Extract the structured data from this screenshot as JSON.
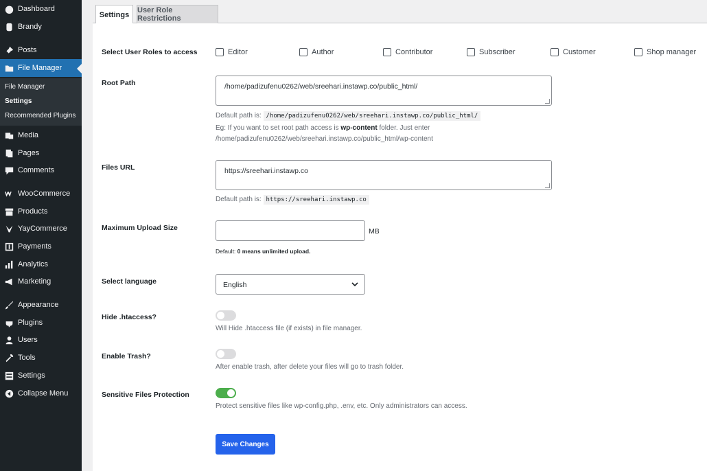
{
  "sidebar": {
    "items": [
      {
        "label": "Dashboard",
        "icon": "dashboard-icon"
      },
      {
        "label": "Brandy",
        "icon": "brandy-icon"
      },
      {
        "label": "Posts",
        "icon": "pin-icon"
      },
      {
        "label": "File Manager",
        "icon": "folder-icon"
      },
      {
        "label": "Media",
        "icon": "media-icon"
      },
      {
        "label": "Pages",
        "icon": "pages-icon"
      },
      {
        "label": "Comments",
        "icon": "comment-icon"
      },
      {
        "label": "WooCommerce",
        "icon": "woocommerce-icon"
      },
      {
        "label": "Products",
        "icon": "archive-icon"
      },
      {
        "label": "YayCommerce",
        "icon": "yaycommerce-icon"
      },
      {
        "label": "Payments",
        "icon": "payments-icon"
      },
      {
        "label": "Analytics",
        "icon": "analytics-icon"
      },
      {
        "label": "Marketing",
        "icon": "megaphone-icon"
      },
      {
        "label": "Appearance",
        "icon": "brush-icon"
      },
      {
        "label": "Plugins",
        "icon": "plugin-icon"
      },
      {
        "label": "Users",
        "icon": "user-icon"
      },
      {
        "label": "Tools",
        "icon": "wrench-icon"
      },
      {
        "label": "Settings",
        "icon": "settings-icon"
      },
      {
        "label": "Collapse Menu",
        "icon": "collapse-icon"
      }
    ],
    "submenu": [
      "File Manager",
      "Settings",
      "Recommended Plugins"
    ]
  },
  "tabs": {
    "settings": "Settings",
    "restrictions": "User Role Restrictions"
  },
  "roles": {
    "label": "Select User Roles to access",
    "options": [
      "Editor",
      "Author",
      "Contributor",
      "Subscriber",
      "Customer",
      "Shop manager"
    ]
  },
  "root_path": {
    "label": "Root Path",
    "value": "/home/padizufenu0262/web/sreehari.instawp.co/public_html/",
    "default_prefix": "Default path is:",
    "default_value": "/home/padizufenu0262/web/sreehari.instawp.co/public_html/",
    "eg_prefix": "Eg: If you want to set root path access is",
    "eg_strong": "wp-content",
    "eg_suffix": "folder. Just enter",
    "eg_path": "/home/padizufenu0262/web/sreehari.instawp.co/public_html/wp-content"
  },
  "files_url": {
    "label": "Files URL",
    "value": "https://sreehari.instawp.co",
    "default_prefix": "Default path is:",
    "default_value": "https://sreehari.instawp.co"
  },
  "upload": {
    "label": "Maximum Upload Size",
    "value": "",
    "unit": "MB",
    "note_prefix": "Default:",
    "note_strong": "0 means unlimited upload."
  },
  "language": {
    "label": "Select language",
    "value": "English"
  },
  "htaccess": {
    "label": "Hide .htaccess?",
    "enabled": false,
    "desc": "Will Hide .htaccess file (if exists) in file manager."
  },
  "trash": {
    "label": "Enable Trash?",
    "enabled": false,
    "desc": "After enable trash, after delete your files will go to trash folder."
  },
  "sensitive": {
    "label": "Sensitive Files Protection",
    "enabled": true,
    "desc": "Protect sensitive files like wp-config.php, .env, etc. Only administrators can access."
  },
  "save_label": "Save Changes",
  "colors": {
    "sidebar": "#1d2327",
    "active": "#2271b1",
    "toggle_on": "#4cae4c",
    "save": "#2563eb"
  }
}
